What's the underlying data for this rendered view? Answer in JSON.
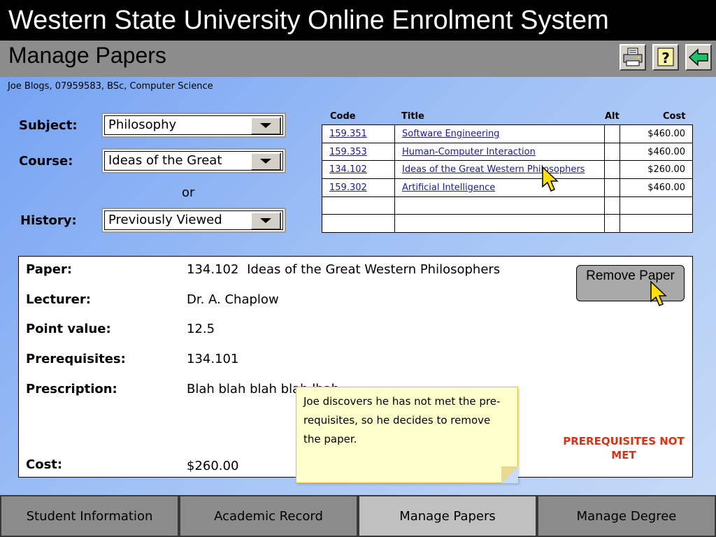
{
  "header": {
    "app_title": "Western State University Online Enrolment System",
    "page_title": "Manage Papers"
  },
  "toolbar": {
    "print_icon": "printer-icon",
    "help_icon": "help-icon",
    "back_icon": "back-arrow-icon",
    "back_color": "#19c16a"
  },
  "student": {
    "info": "Joe Blogs, 07959583, BSc, Computer Science"
  },
  "filters": {
    "subject_label": "Subject:",
    "subject_value": "Philosophy",
    "course_label": "Course:",
    "course_value": "Ideas of the Great",
    "or_text": "or",
    "history_label": "History:",
    "history_value": "Previously Viewed"
  },
  "papers_table": {
    "headers": {
      "code": "Code",
      "title": "Title",
      "alt": "Alt",
      "cost": "Cost"
    },
    "rows": [
      {
        "code": "159.351",
        "title": "Software Engineering",
        "cost": "$460.00"
      },
      {
        "code": "159.353",
        "title": "Human-Computer Interaction",
        "cost": "$460.00"
      },
      {
        "code": "134.102",
        "title": "Ideas of the Great Western Philosophers",
        "cost": "$260.00"
      },
      {
        "code": "159.302",
        "title": "Artificial Intelligence",
        "cost": "$460.00"
      }
    ],
    "empty_rows": 2
  },
  "detail": {
    "paper_label": "Paper:",
    "paper_code": "134.102",
    "paper_title": "Ideas of the Great Western Philosophers",
    "lecturer_label": "Lecturer:",
    "lecturer_value": "Dr. A. Chaplow",
    "points_label": "Point value:",
    "points_value": "12.5",
    "prereq_label": "Prerequisites:",
    "prereq_value": "134.101",
    "prescription_label": "Prescription:",
    "prescription_value": "Blah blah blah blah lbah",
    "cost_label": "Cost:",
    "cost_value": "$260.00",
    "remove_button": "Remove Paper",
    "warning": "PREREQUISITES NOT MET",
    "warning_color": "#e03010"
  },
  "note": {
    "text": "Joe discovers he has not met the pre-requisites, so he decides to remove the paper."
  },
  "tabs": [
    {
      "label": "Student Information",
      "active": false
    },
    {
      "label": "Academic Record",
      "active": false
    },
    {
      "label": "Manage Papers",
      "active": true
    },
    {
      "label": "Manage Degree",
      "active": false
    }
  ]
}
